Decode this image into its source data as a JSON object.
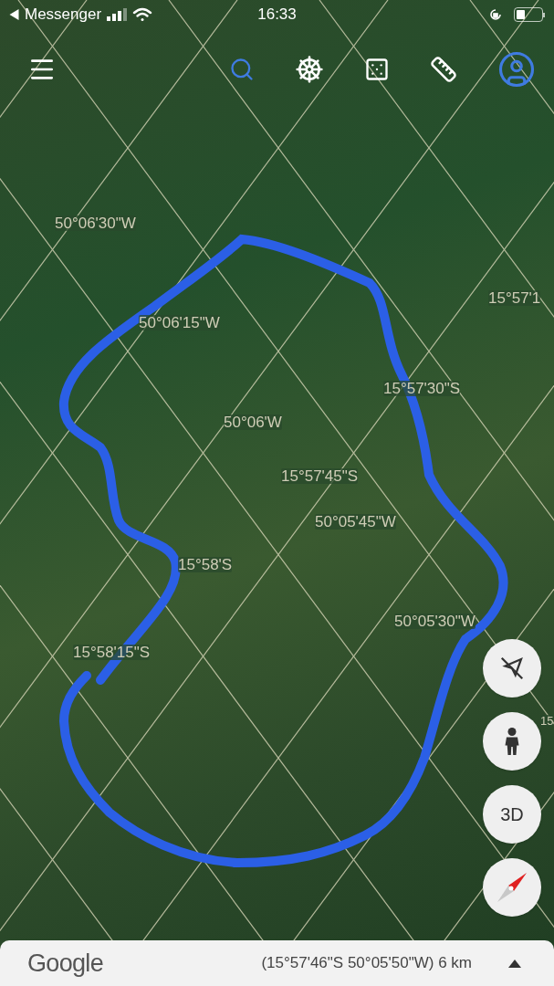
{
  "status_bar": {
    "back_label": "Messenger",
    "time": "16:33"
  },
  "map": {
    "grid_labels": [
      {
        "text": "50°06'30\"W"
      },
      {
        "text": "15°57'1"
      },
      {
        "text": "50°06'15\"W"
      },
      {
        "text": "15°57'30\"S"
      },
      {
        "text": "50°06'W"
      },
      {
        "text": "15°57'45\"S"
      },
      {
        "text": "50°05'45\"W"
      },
      {
        "text": "15°58'S"
      },
      {
        "text": "50°05'30\"W"
      },
      {
        "text": "15°58'15\"S"
      },
      {
        "text": "15"
      }
    ]
  },
  "map_controls": [
    {
      "kind": "tilt-off"
    },
    {
      "kind": "street-view"
    },
    {
      "kind": "text",
      "label": "3D"
    },
    {
      "kind": "compass"
    }
  ],
  "footer": {
    "logo": "Google",
    "coordinates": "(15°57'46\"S 50°05'50\"W) 6 km"
  }
}
